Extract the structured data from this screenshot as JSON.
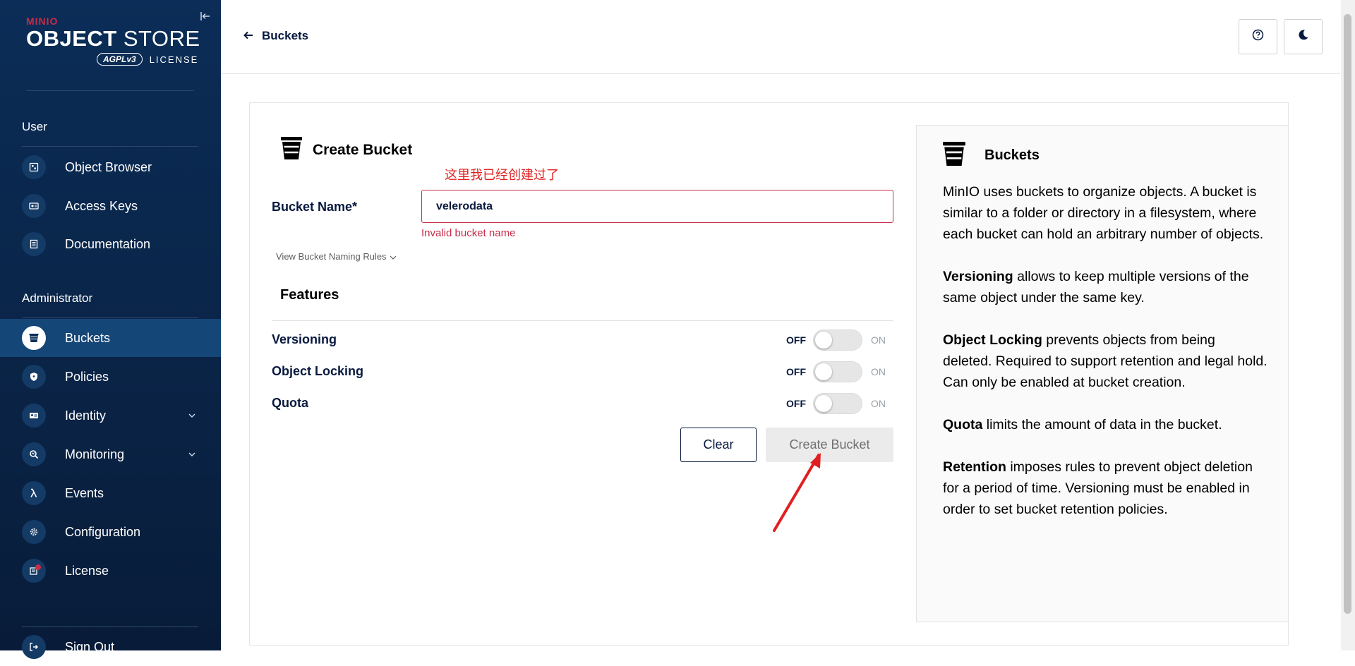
{
  "sidebar": {
    "logo": {
      "brand": "MINIO",
      "title_bold": "OBJECT",
      "title_light": " STORE",
      "agpl": "AGPLv3",
      "license": "LICENSE"
    },
    "sections": {
      "user": "User",
      "admin": "Administrator"
    },
    "user_items": [
      {
        "label": "Object Browser",
        "icon": "object-browser-icon"
      },
      {
        "label": "Access Keys",
        "icon": "access-keys-icon"
      },
      {
        "label": "Documentation",
        "icon": "documentation-icon"
      }
    ],
    "admin_items": [
      {
        "label": "Buckets",
        "icon": "bucket-icon",
        "active": true
      },
      {
        "label": "Policies",
        "icon": "shield-icon"
      },
      {
        "label": "Identity",
        "icon": "identity-icon",
        "expandable": true
      },
      {
        "label": "Monitoring",
        "icon": "monitoring-icon",
        "expandable": true
      },
      {
        "label": "Events",
        "icon": "lambda-icon"
      },
      {
        "label": "Configuration",
        "icon": "gear-icon"
      },
      {
        "label": "License",
        "icon": "license-icon"
      }
    ],
    "sign_out": "Sign Out"
  },
  "header": {
    "back_label": "Buckets",
    "help_icon": "question-circle-icon",
    "theme_icon": "moon-icon"
  },
  "form": {
    "title": "Create Bucket",
    "annotation": "这里我已经创建过了",
    "bucket_name_label": "Bucket Name*",
    "bucket_name_value": "velerodata",
    "error": "Invalid bucket name",
    "naming_rules": "View Bucket Naming Rules",
    "features_title": "Features",
    "features": [
      {
        "label": "Versioning",
        "off": "OFF",
        "on": "ON",
        "enabled": false
      },
      {
        "label": "Object Locking",
        "off": "OFF",
        "on": "ON",
        "enabled": false
      },
      {
        "label": "Quota",
        "off": "OFF",
        "on": "ON",
        "enabled": false
      }
    ],
    "clear_label": "Clear",
    "create_label": "Create Bucket"
  },
  "help": {
    "title": "Buckets",
    "intro": "MinIO uses buckets to organize objects. A bucket is similar to a folder or directory in a filesystem, where each bucket can hold an arbitrary number of objects.",
    "versioning_term": "Versioning",
    "versioning_text": " allows to keep multiple versions of the same object under the same key.",
    "locking_term": "Object Locking",
    "locking_text": " prevents objects from being deleted. Required to support retention and legal hold. Can only be enabled at bucket creation.",
    "quota_term": "Quota",
    "quota_text": " limits the amount of data in the bucket.",
    "retention_term": "Retention",
    "retention_text": " imposes rules to prevent object deletion for a period of time. Versioning must be enabled in order to set bucket retention policies."
  },
  "colors": {
    "sidebar": "#0b2d57",
    "accent": "#c72c48",
    "annotation": "#e02020"
  }
}
